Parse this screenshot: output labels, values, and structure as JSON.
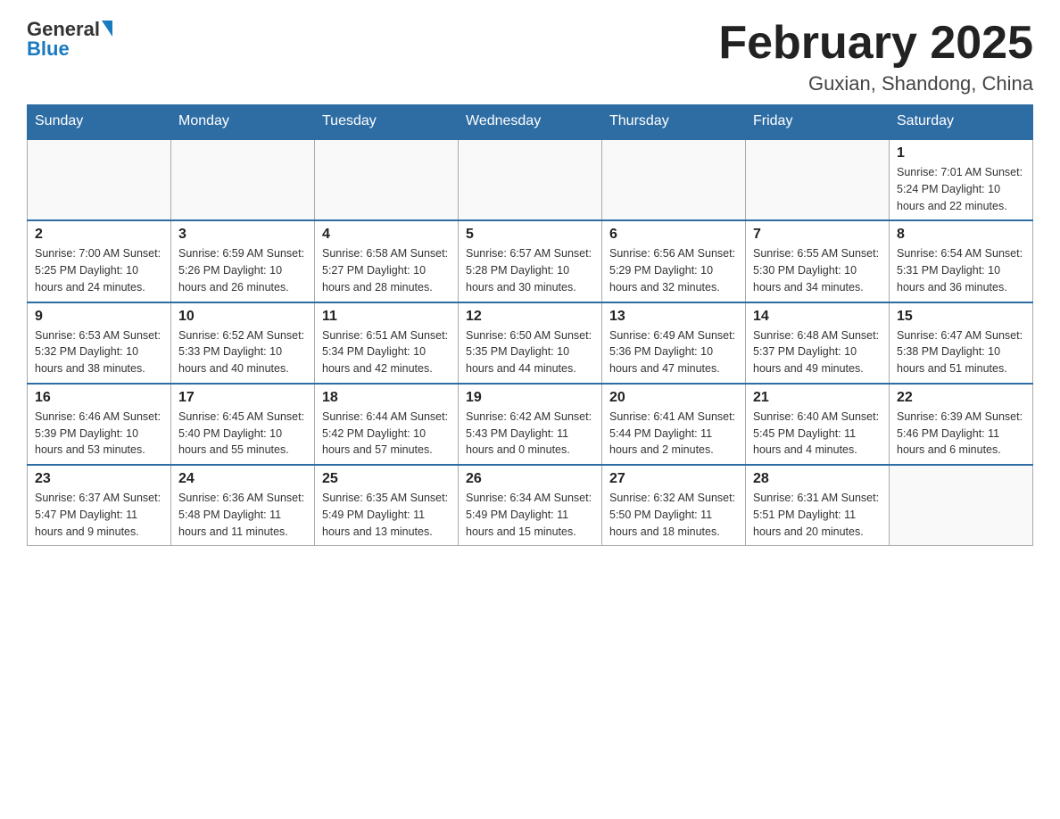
{
  "logo": {
    "general": "General",
    "blue": "Blue"
  },
  "title": "February 2025",
  "location": "Guxian, Shandong, China",
  "days_of_week": [
    "Sunday",
    "Monday",
    "Tuesday",
    "Wednesday",
    "Thursday",
    "Friday",
    "Saturday"
  ],
  "weeks": [
    [
      {
        "day": "",
        "info": ""
      },
      {
        "day": "",
        "info": ""
      },
      {
        "day": "",
        "info": ""
      },
      {
        "day": "",
        "info": ""
      },
      {
        "day": "",
        "info": ""
      },
      {
        "day": "",
        "info": ""
      },
      {
        "day": "1",
        "info": "Sunrise: 7:01 AM\nSunset: 5:24 PM\nDaylight: 10 hours and 22 minutes."
      }
    ],
    [
      {
        "day": "2",
        "info": "Sunrise: 7:00 AM\nSunset: 5:25 PM\nDaylight: 10 hours and 24 minutes."
      },
      {
        "day": "3",
        "info": "Sunrise: 6:59 AM\nSunset: 5:26 PM\nDaylight: 10 hours and 26 minutes."
      },
      {
        "day": "4",
        "info": "Sunrise: 6:58 AM\nSunset: 5:27 PM\nDaylight: 10 hours and 28 minutes."
      },
      {
        "day": "5",
        "info": "Sunrise: 6:57 AM\nSunset: 5:28 PM\nDaylight: 10 hours and 30 minutes."
      },
      {
        "day": "6",
        "info": "Sunrise: 6:56 AM\nSunset: 5:29 PM\nDaylight: 10 hours and 32 minutes."
      },
      {
        "day": "7",
        "info": "Sunrise: 6:55 AM\nSunset: 5:30 PM\nDaylight: 10 hours and 34 minutes."
      },
      {
        "day": "8",
        "info": "Sunrise: 6:54 AM\nSunset: 5:31 PM\nDaylight: 10 hours and 36 minutes."
      }
    ],
    [
      {
        "day": "9",
        "info": "Sunrise: 6:53 AM\nSunset: 5:32 PM\nDaylight: 10 hours and 38 minutes."
      },
      {
        "day": "10",
        "info": "Sunrise: 6:52 AM\nSunset: 5:33 PM\nDaylight: 10 hours and 40 minutes."
      },
      {
        "day": "11",
        "info": "Sunrise: 6:51 AM\nSunset: 5:34 PM\nDaylight: 10 hours and 42 minutes."
      },
      {
        "day": "12",
        "info": "Sunrise: 6:50 AM\nSunset: 5:35 PM\nDaylight: 10 hours and 44 minutes."
      },
      {
        "day": "13",
        "info": "Sunrise: 6:49 AM\nSunset: 5:36 PM\nDaylight: 10 hours and 47 minutes."
      },
      {
        "day": "14",
        "info": "Sunrise: 6:48 AM\nSunset: 5:37 PM\nDaylight: 10 hours and 49 minutes."
      },
      {
        "day": "15",
        "info": "Sunrise: 6:47 AM\nSunset: 5:38 PM\nDaylight: 10 hours and 51 minutes."
      }
    ],
    [
      {
        "day": "16",
        "info": "Sunrise: 6:46 AM\nSunset: 5:39 PM\nDaylight: 10 hours and 53 minutes."
      },
      {
        "day": "17",
        "info": "Sunrise: 6:45 AM\nSunset: 5:40 PM\nDaylight: 10 hours and 55 minutes."
      },
      {
        "day": "18",
        "info": "Sunrise: 6:44 AM\nSunset: 5:42 PM\nDaylight: 10 hours and 57 minutes."
      },
      {
        "day": "19",
        "info": "Sunrise: 6:42 AM\nSunset: 5:43 PM\nDaylight: 11 hours and 0 minutes."
      },
      {
        "day": "20",
        "info": "Sunrise: 6:41 AM\nSunset: 5:44 PM\nDaylight: 11 hours and 2 minutes."
      },
      {
        "day": "21",
        "info": "Sunrise: 6:40 AM\nSunset: 5:45 PM\nDaylight: 11 hours and 4 minutes."
      },
      {
        "day": "22",
        "info": "Sunrise: 6:39 AM\nSunset: 5:46 PM\nDaylight: 11 hours and 6 minutes."
      }
    ],
    [
      {
        "day": "23",
        "info": "Sunrise: 6:37 AM\nSunset: 5:47 PM\nDaylight: 11 hours and 9 minutes."
      },
      {
        "day": "24",
        "info": "Sunrise: 6:36 AM\nSunset: 5:48 PM\nDaylight: 11 hours and 11 minutes."
      },
      {
        "day": "25",
        "info": "Sunrise: 6:35 AM\nSunset: 5:49 PM\nDaylight: 11 hours and 13 minutes."
      },
      {
        "day": "26",
        "info": "Sunrise: 6:34 AM\nSunset: 5:49 PM\nDaylight: 11 hours and 15 minutes."
      },
      {
        "day": "27",
        "info": "Sunrise: 6:32 AM\nSunset: 5:50 PM\nDaylight: 11 hours and 18 minutes."
      },
      {
        "day": "28",
        "info": "Sunrise: 6:31 AM\nSunset: 5:51 PM\nDaylight: 11 hours and 20 minutes."
      },
      {
        "day": "",
        "info": ""
      }
    ]
  ]
}
